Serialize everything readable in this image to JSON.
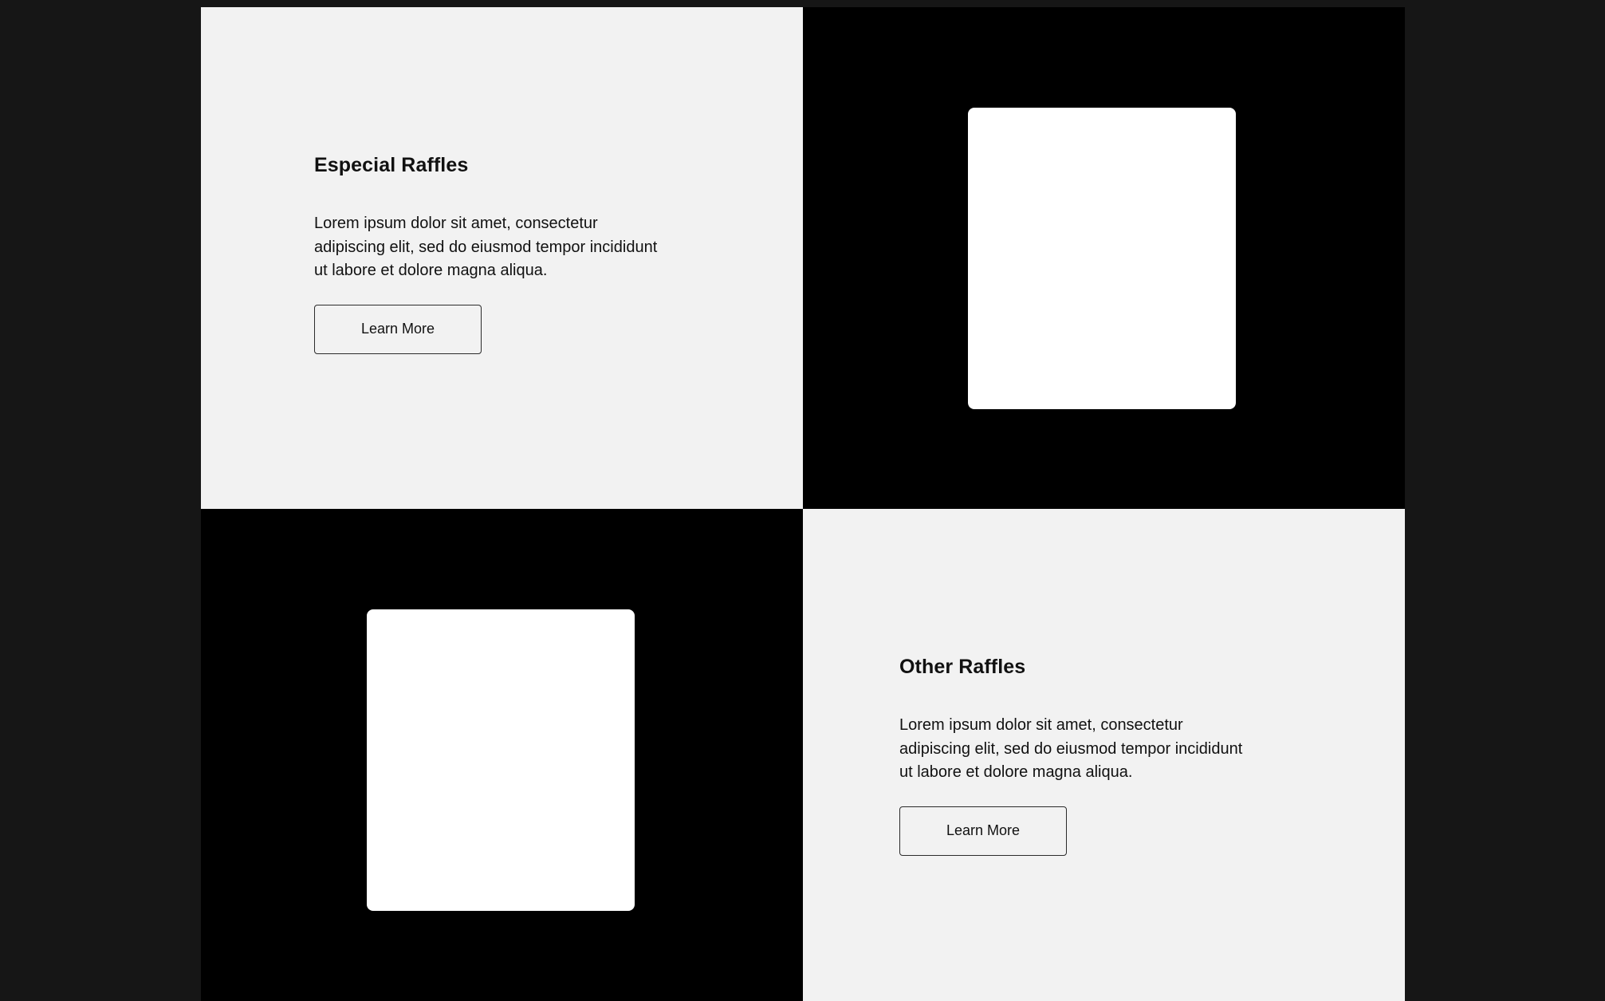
{
  "sections": [
    {
      "title": "Especial Raffles",
      "body": "Lorem ipsum dolor sit amet, consectetur adipiscing elit, sed do eiusmod tempor incididunt ut labore et dolore magna aliqua.",
      "button_label": "Learn More"
    },
    {
      "title": "Other Raffles",
      "body": "Lorem ipsum dolor sit amet, consectetur adipiscing elit, sed do eiusmod tempor incididunt ut labore et dolore magna aliqua.",
      "button_label": "Learn More"
    }
  ],
  "colors": {
    "page_background": "#161616",
    "light_panel": "#f2f2f2",
    "dark_panel": "#000000",
    "image_placeholder": "#ffffff",
    "text": "#111111"
  }
}
